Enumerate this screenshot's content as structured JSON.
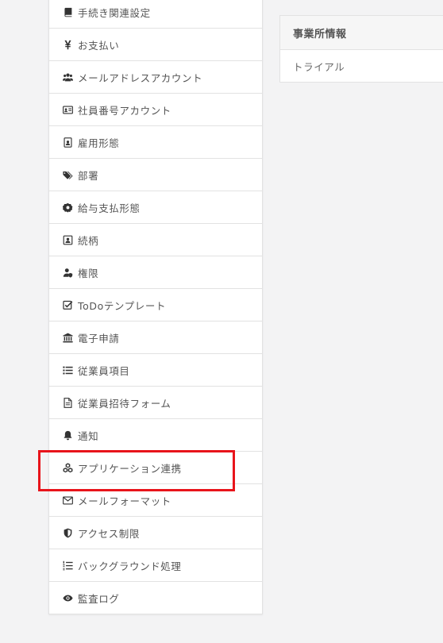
{
  "menu": {
    "items": [
      {
        "label": "手続き関連設定",
        "icon": "book-icon"
      },
      {
        "label": "お支払い",
        "icon": "yen-icon"
      },
      {
        "label": "メールアドレスアカウント",
        "icon": "users-icon"
      },
      {
        "label": "社員番号アカウント",
        "icon": "id-card-icon"
      },
      {
        "label": "雇用形態",
        "icon": "badge-icon"
      },
      {
        "label": "部署",
        "icon": "tags-icon"
      },
      {
        "label": "給与支払形態",
        "icon": "gem-icon"
      },
      {
        "label": "続柄",
        "icon": "contact-icon"
      },
      {
        "label": "権限",
        "icon": "user-shield-icon"
      },
      {
        "label": "ToDoテンプレート",
        "icon": "check-square-icon"
      },
      {
        "label": "電子申請",
        "icon": "bank-icon"
      },
      {
        "label": "従業員項目",
        "icon": "list-icon"
      },
      {
        "label": "従業員招待フォーム",
        "icon": "document-icon"
      },
      {
        "label": "通知",
        "icon": "bell-icon"
      },
      {
        "label": "アプリケーション連携",
        "icon": "cubes-icon"
      },
      {
        "label": "メールフォーマット",
        "icon": "envelope-icon"
      },
      {
        "label": "アクセス制限",
        "icon": "shield-icon"
      },
      {
        "label": "バックグラウンド処理",
        "icon": "ordered-list-icon"
      },
      {
        "label": "監査ログ",
        "icon": "eye-icon"
      }
    ]
  },
  "panel": {
    "title": "事業所情報",
    "value": "トライアル"
  },
  "highlight_color": "#e8141b"
}
